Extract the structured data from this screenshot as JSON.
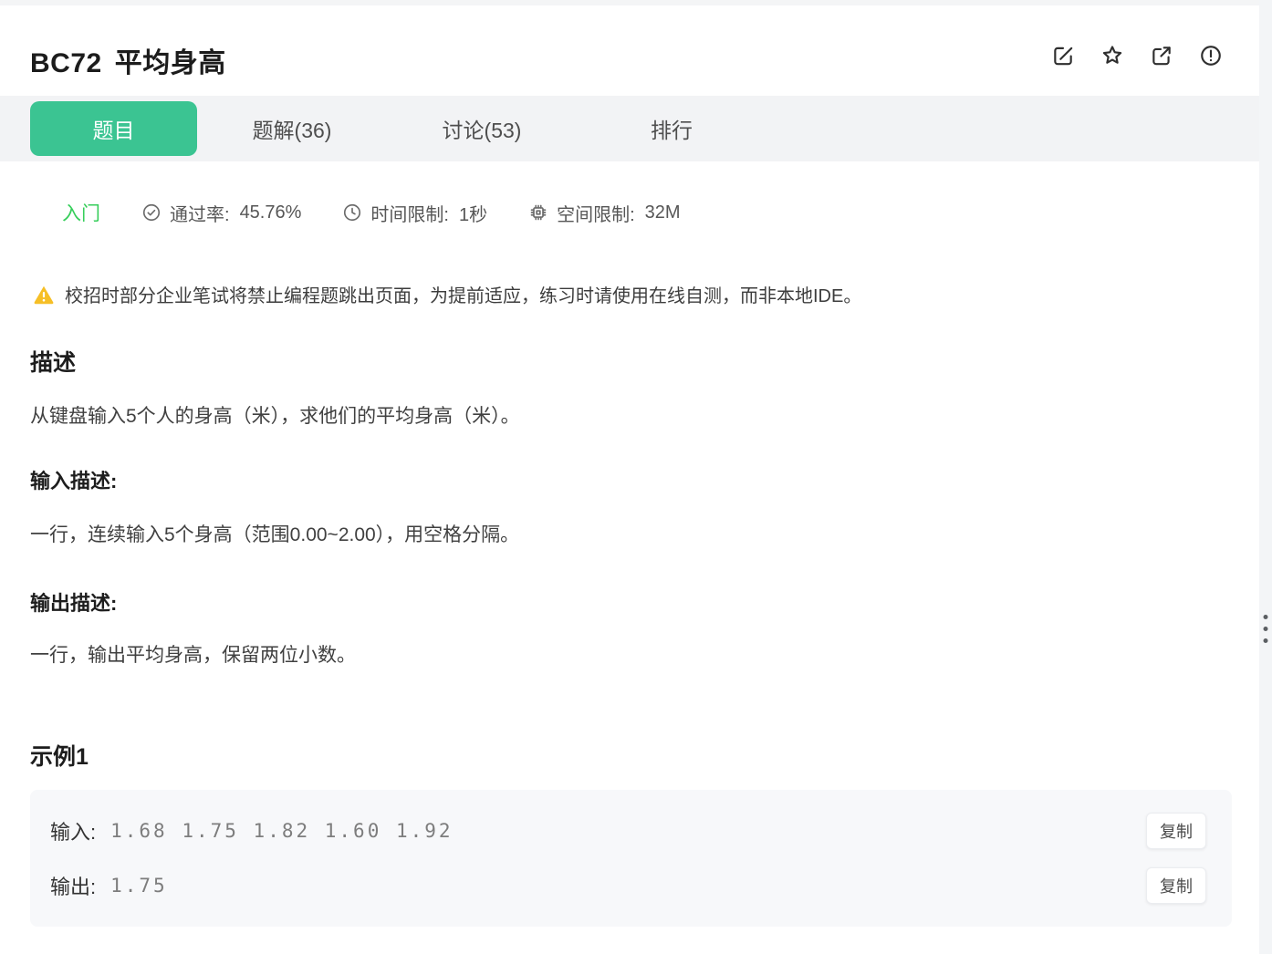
{
  "header": {
    "problem_id": "BC72",
    "title": "平均身高",
    "icons": [
      "edit",
      "star",
      "share",
      "report"
    ]
  },
  "tabs": [
    {
      "label": "题目",
      "active": true
    },
    {
      "label": "题解(36)",
      "active": false
    },
    {
      "label": "讨论(53)",
      "active": false
    },
    {
      "label": "排行",
      "active": false
    }
  ],
  "meta": {
    "difficulty": "入门",
    "stats": [
      {
        "icon": "check-circle-icon",
        "label": "通过率:",
        "value": "45.76%"
      },
      {
        "icon": "clock-icon",
        "label": "时间限制:",
        "value": "1秒"
      },
      {
        "icon": "chip-icon",
        "label": "空间限制:",
        "value": "32M"
      }
    ]
  },
  "notice": {
    "icon": "warning-triangle-icon",
    "text": "校招时部分企业笔试将禁止编程题跳出页面，为提前适应，练习时请使用在线自测，而非本地IDE。"
  },
  "sections": {
    "description": {
      "heading": "描述",
      "body": "从键盘输入5个人的身高（米），求他们的平均身高（米）。"
    },
    "input_desc": {
      "heading": "输入描述:",
      "body": "一行，连续输入5个身高（范围0.00~2.00），用空格分隔。"
    },
    "output_desc": {
      "heading": "输出描述:",
      "body": "一行，输出平均身高，保留两位小数。"
    }
  },
  "example": {
    "heading": "示例1",
    "rows": [
      {
        "label": "输入:",
        "value": "1.68 1.75 1.82 1.60 1.92",
        "copy_label": "复制"
      },
      {
        "label": "输出:",
        "value": "1.75",
        "copy_label": "复制"
      }
    ]
  },
  "colors": {
    "accent_green": "#3bc492",
    "difficulty_green": "#36ce5a",
    "warning_yellow": "#f6bf26",
    "tabbar_bg": "#f2f3f5",
    "example_bg": "#f7f8fa"
  }
}
